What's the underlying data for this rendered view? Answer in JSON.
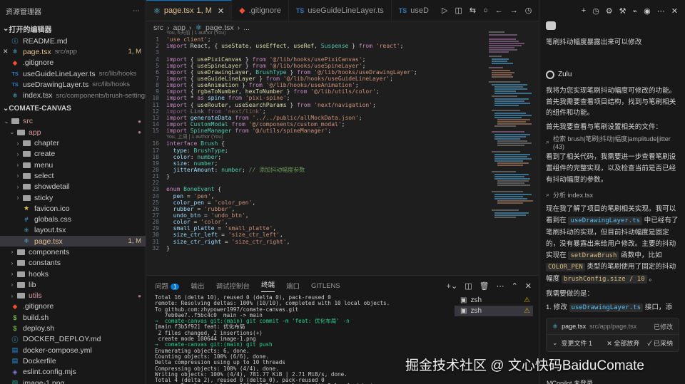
{
  "sidebar": {
    "title": "资源管理器",
    "open_editors_label": "打开的编辑器",
    "open_editors": [
      {
        "name": "README.md",
        "desc": "",
        "badge": "",
        "icon": "info-icon"
      },
      {
        "name": "page.tsx",
        "desc": "src/app",
        "badge": "1, M",
        "icon": "react-icon",
        "close": "✕"
      },
      {
        "name": ".gitignore",
        "desc": "",
        "badge": "",
        "icon": "git-icon"
      },
      {
        "name": "useGuideLineLayer.ts",
        "desc": "src/lib/hooks",
        "badge": "",
        "icon": "ts-icon"
      },
      {
        "name": "useDrawingLayer.ts",
        "desc": "src/lib/hooks",
        "badge": "",
        "icon": "ts-icon"
      },
      {
        "name": "index.tsx",
        "desc": "src/components/brush-settings",
        "badge": "",
        "icon": "react-icon"
      }
    ],
    "project_label": "COMATE-CANVAS",
    "tree": [
      {
        "name": "src",
        "depth": 1,
        "type": "folder-open",
        "dot": true
      },
      {
        "name": "app",
        "depth": 2,
        "type": "folder-open",
        "dot": true
      },
      {
        "name": "chapter",
        "depth": 3,
        "type": "folder"
      },
      {
        "name": "create",
        "depth": 3,
        "type": "folder"
      },
      {
        "name": "menu",
        "depth": 3,
        "type": "folder"
      },
      {
        "name": "select",
        "depth": 3,
        "type": "folder"
      },
      {
        "name": "showdetail",
        "depth": 3,
        "type": "folder"
      },
      {
        "name": "sticky",
        "depth": 3,
        "type": "folder"
      },
      {
        "name": "favicon.ico",
        "depth": 3,
        "type": "star"
      },
      {
        "name": "globals.css",
        "depth": 3,
        "type": "css"
      },
      {
        "name": "layout.tsx",
        "depth": 3,
        "type": "react"
      },
      {
        "name": "page.tsx",
        "depth": 3,
        "type": "react",
        "badge": "1, M",
        "selected": true
      },
      {
        "name": "components",
        "depth": 2,
        "type": "folder"
      },
      {
        "name": "constants",
        "depth": 2,
        "type": "folder"
      },
      {
        "name": "hooks",
        "depth": 2,
        "type": "folder"
      },
      {
        "name": "lib",
        "depth": 2,
        "type": "folder"
      },
      {
        "name": "utils",
        "depth": 2,
        "type": "folder",
        "dot": true
      },
      {
        "name": ".gitignore",
        "depth": 1,
        "type": "git"
      },
      {
        "name": "build.sh",
        "depth": 1,
        "type": "sh"
      },
      {
        "name": "deploy.sh",
        "depth": 1,
        "type": "sh"
      },
      {
        "name": "DOCKER_DEPLOY.md",
        "depth": 1,
        "type": "info"
      },
      {
        "name": "docker-compose.yml",
        "depth": 1,
        "type": "docker"
      },
      {
        "name": "Dockerfile",
        "depth": 1,
        "type": "docker"
      },
      {
        "name": "eslint.config.mjs",
        "depth": 1,
        "type": "eslint"
      },
      {
        "name": "image-1.png",
        "depth": 1,
        "type": "image"
      },
      {
        "name": "image.png",
        "depth": 1,
        "type": "image"
      }
    ]
  },
  "editor": {
    "tabs": [
      {
        "label": "page.tsx",
        "badge": "1, M",
        "active": true,
        "close": "✕"
      },
      {
        "label": ".gitignore",
        "active": false
      },
      {
        "label": "useGuideLineLayer.ts",
        "active": false
      },
      {
        "label": "useD",
        "active": false
      }
    ],
    "breadcrumb": [
      "src",
      "app",
      "page.tsx",
      "..."
    ],
    "blame_1": "You, 6天前 | 1 author (You)",
    "blame_2": "You, 上周 | 1 author (You)"
  },
  "panel": {
    "tabs": [
      "问题",
      "输出",
      "调试控制台",
      "终端",
      "端口",
      "GITLENS"
    ],
    "problem_count": "1",
    "active_tab": "终端",
    "terminal_lines": [
      "Total 16 (delta 10), reused 0 (delta 0), pack-reused 0",
      "remote: Resolving deltas: 100% (10/10), completed with 10 local objects.",
      "To github.com:zhypower1997/comate-canvas.git",
      "   7eb0ae7..f5bc4c0  main -> main",
      "→  comate-canvas git:(main) git commit -m 'feat: 优化布局' -n",
      "[main f3b5f92] feat: 优化布局",
      " 2 files changed, 2 insertions(+)",
      " create mode 100644 image-1.png",
      "→  comate-canvas git:(main) git push",
      "Enumerating objects: 6, done.",
      "Counting objects: 100% (6/6), done.",
      "Delta compression using up to 10 threads",
      "Compressing objects: 100% (4/4), done.",
      "Writing objects: 100% (4/4), 781.77 KiB | 2.71 MiB/s, done.",
      "Total 4 (delta 2), reused 0 (delta 0), pack-reused 0",
      "remote: Resolving deltas: 100% (2/2), completed with 2 local objects."
    ],
    "terminals": [
      "zsh",
      "zsh"
    ]
  },
  "chat": {
    "user_message": "笔刷抖动幅度暴露出来可以修改",
    "assistant_name": "Zulu",
    "p1": "我将为您实现笔刷抖动幅度可修改的功能。首先我需要查看项目结构，找到与笔刷相关的组件和功能。",
    "p2": "首先我要查看与笔刷设置相关的文件：",
    "tool1": "检索 brush|笔刷|抖动|幅度|amplitude|jitter (43)",
    "p3": "看到了相关代码，我需要进一步查看笔刷设置组件的完整实现，以及检查当前是否已经有抖动幅度的参数。",
    "tool2": "分析 index.tsx",
    "p4_a": "现在我了解了项目的笔刷相关实现。我可以看到在",
    "p4_code1": "useDrawingLayer.ts",
    "p4_b": "中已经有了笔刷抖动的实现，但目前抖动幅度是固定的，没有暴露出来给用户修改。主要的抖动实现在",
    "p4_code2": "setDrawBrush",
    "p4_c": "函数中，比如",
    "p4_code3": "COLOR_PEN",
    "p4_d": "类型的笔刷使用了固定的抖动幅度",
    "p4_code4": "brushConfig.size / 10",
    "p4_e": "。",
    "p5": "我需要做的是：",
    "p6_a": "1. 修改",
    "p6_code": "useDrawingLayer.ts",
    "p6_b": "接口，添",
    "file_name": "page.tsx",
    "file_path": "src/app/page.tsx",
    "file_status": "已修改",
    "changes_label": "变更文件 1",
    "reject_all": "全部放弃",
    "accept_all": "已采纳",
    "copilot": "MCopilot 未登录"
  },
  "watermark": "掘金技术社区 @ 文心快码BaiduComate"
}
